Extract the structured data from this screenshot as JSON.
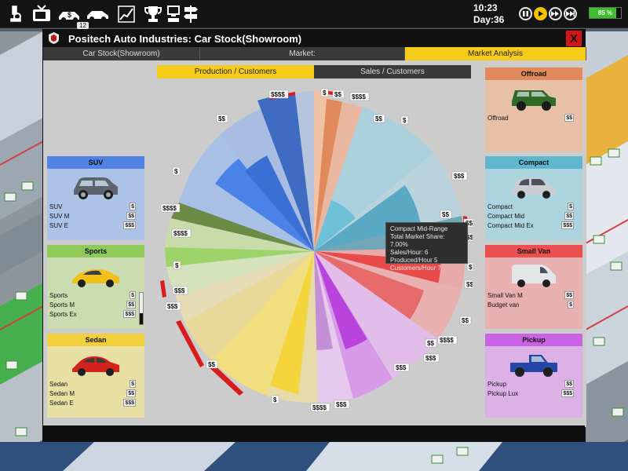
{
  "hud": {
    "time": "10:23",
    "day": "Day:36",
    "badge": "12",
    "battery_pct": 85,
    "battery_label": "85 %",
    "icons": [
      "microscope-icon",
      "tv-icon",
      "money-car-icon",
      "car-icon",
      "chart-icon",
      "trophy-icon",
      "computer-icon",
      "signpost-icon"
    ]
  },
  "window": {
    "title": "Positech Auto Industries: Car Stock(Showroom)",
    "close_label": "X",
    "tabs": [
      {
        "label": "Car Stock(Showroom)",
        "active": false
      },
      {
        "label": "Market:",
        "active": false
      },
      {
        "label": "Market Analysis",
        "active": true
      }
    ],
    "subtabs": [
      {
        "label": "Production / Customers",
        "active": true
      },
      {
        "label": "Sales / Customers",
        "active": false
      }
    ]
  },
  "categories": {
    "suv": {
      "title": "SUV",
      "color": "#4f82e3",
      "bg": "#acc2e6",
      "rows": [
        {
          "name": "SUV",
          "price": "$"
        },
        {
          "name": "SUV M",
          "price": "$$"
        },
        {
          "name": "SUV E",
          "price": "$$$"
        }
      ]
    },
    "sports": {
      "title": "Sports",
      "color": "#8ec95a",
      "bg": "#cbdcb0",
      "rows": [
        {
          "name": "Sports",
          "price": "$"
        },
        {
          "name": "Sports M",
          "price": "$$"
        },
        {
          "name": "Sports Ex",
          "price": "$$$"
        }
      ]
    },
    "sedan": {
      "title": "Sedan",
      "color": "#f2d03b",
      "bg": "#e8dfa4",
      "rows": [
        {
          "name": "Sedan",
          "price": "$"
        },
        {
          "name": "Sedan M",
          "price": "$$"
        },
        {
          "name": "Sedan E",
          "price": "$$$"
        }
      ]
    },
    "offroad": {
      "title": "Offroad",
      "color": "#e0895a",
      "bg": "#e7c0a6",
      "rows": [
        {
          "name": "Offroad",
          "price": "$$"
        }
      ]
    },
    "compact": {
      "title": "Compact",
      "color": "#5fb6cf",
      "bg": "#acd4df",
      "rows": [
        {
          "name": "Compact",
          "price": "$"
        },
        {
          "name": "Compact Mid",
          "price": "$$"
        },
        {
          "name": "Compact Mid Ex",
          "price": "$$$"
        }
      ]
    },
    "smallvan": {
      "title": "Small Van",
      "color": "#ec5050",
      "bg": "#e8b0b0",
      "rows": [
        {
          "name": "Small Van M",
          "price": "$$"
        },
        {
          "name": "Budget van",
          "price": "$"
        }
      ]
    },
    "pickup": {
      "title": "Pickup",
      "color": "#c962e3",
      "bg": "#dcb1e6",
      "rows": [
        {
          "name": "Pickup",
          "price": "$$"
        },
        {
          "name": "Pickup Lux",
          "price": "$$$"
        }
      ]
    }
  },
  "tooltip": {
    "title": "Compact  Mid-Range",
    "share": "Total Market Share:  7.00%",
    "sales": "Sales/Hour:  6",
    "produced": "Produced/Hour  5",
    "customers": "Customers/Hour  7"
  },
  "pie_tags": [
    "$$$$",
    "$",
    "$$",
    "$$$$",
    "$",
    "$$",
    "$$$",
    "$$",
    "$$$",
    "$$$$",
    "$",
    "$$",
    "$$",
    "$$$$",
    "$$$",
    "$$$",
    "$$$$",
    "$",
    "$$$",
    "$$",
    "$$$$",
    "$$$",
    "$",
    "$$$$",
    "$$$",
    "$$",
    "$",
    "$$"
  ]
}
